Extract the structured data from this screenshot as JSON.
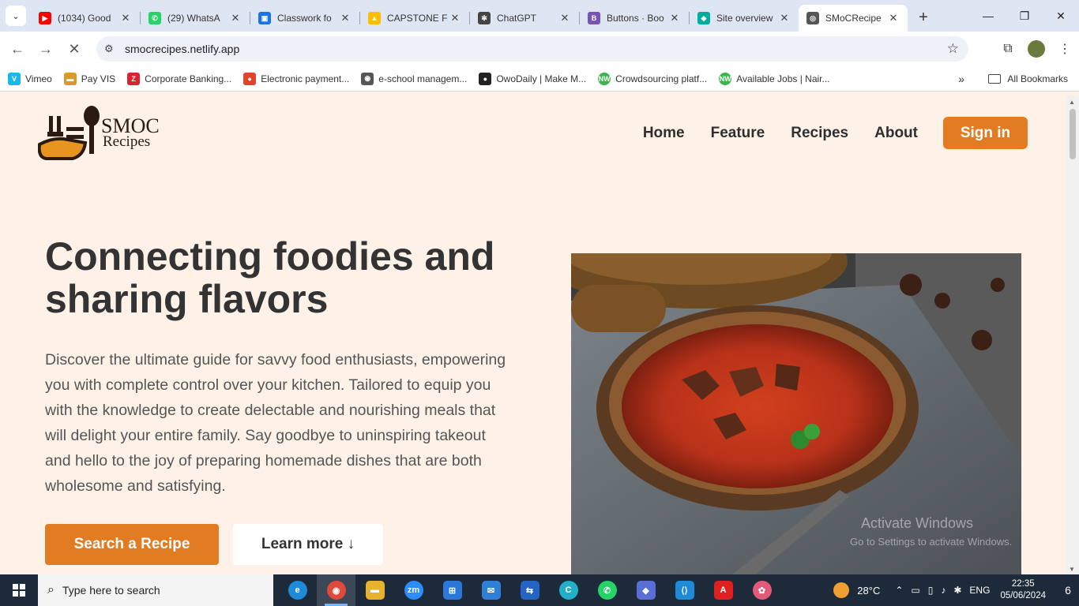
{
  "browser": {
    "tabs": [
      {
        "title": "(1034) Good",
        "color": "#ff0000",
        "glyph": "▶"
      },
      {
        "title": "(29) WhatsA",
        "color": "#25d366",
        "glyph": "✆"
      },
      {
        "title": "Classwork fo",
        "color": "#1a73e8",
        "glyph": "▣"
      },
      {
        "title": "CAPSTONE F",
        "color": "#fbbc04",
        "glyph": "▲"
      },
      {
        "title": "ChatGPT",
        "color": "#444444",
        "glyph": "✻"
      },
      {
        "title": "Buttons · Boo",
        "color": "#7952b3",
        "glyph": "B"
      },
      {
        "title": "Site overview",
        "color": "#00ad9f",
        "glyph": "◆"
      },
      {
        "title": "SMoCRecipe",
        "color": "#555555",
        "glyph": "◎"
      }
    ],
    "url": "smocrecipes.netlify.app",
    "bookmarks": [
      {
        "label": "Vimeo",
        "color": "#1ab7ea",
        "glyph": "V"
      },
      {
        "label": "Pay VIS",
        "color": "#d99a2b",
        "glyph": "▬"
      },
      {
        "label": "Corporate Banking...",
        "color": "#d9232d",
        "glyph": "Z"
      },
      {
        "label": "Electronic payment...",
        "color": "#e0442c",
        "glyph": "●"
      },
      {
        "label": "e-school managem...",
        "color": "#555555",
        "glyph": "◉"
      },
      {
        "label": "OwoDaily | Make M...",
        "color": "#222222",
        "glyph": "●"
      },
      {
        "label": "Crowdsourcing platf...",
        "color": "#3ab54a",
        "glyph": "NW"
      },
      {
        "label": "Available Jobs | Nair...",
        "color": "#3ab54a",
        "glyph": "NW"
      }
    ],
    "all_bookmarks": "All Bookmarks"
  },
  "site": {
    "logo_line1": "SMOC",
    "logo_line2": "Recipes",
    "nav": [
      "Home",
      "Feature",
      "Recipes",
      "About"
    ],
    "signin": "Sign in",
    "hero_title": "Connecting foodies and sharing flavors",
    "hero_text": "Discover the ultimate guide for savvy food enthusiasts, empowering you with complete control over your kitchen. Tailored to equip you with the knowledge to create delectable and nourishing meals that will delight your entire family. Say goodbye to uninspiring takeout and hello to the joy of preparing homemade dishes that are both wholesome and satisfying.",
    "btn_search": "Search a Recipe",
    "btn_learn": "Learn more ↓",
    "accent_color": "#e17c22"
  },
  "watermark": {
    "line1": "Activate Windows",
    "line2": "Go to Settings to activate Windows."
  },
  "taskbar": {
    "search_placeholder": "Type here to search",
    "temperature": "28°C",
    "language": "ENG",
    "time": "22:35",
    "date": "05/06/2024",
    "notifications": "6"
  }
}
